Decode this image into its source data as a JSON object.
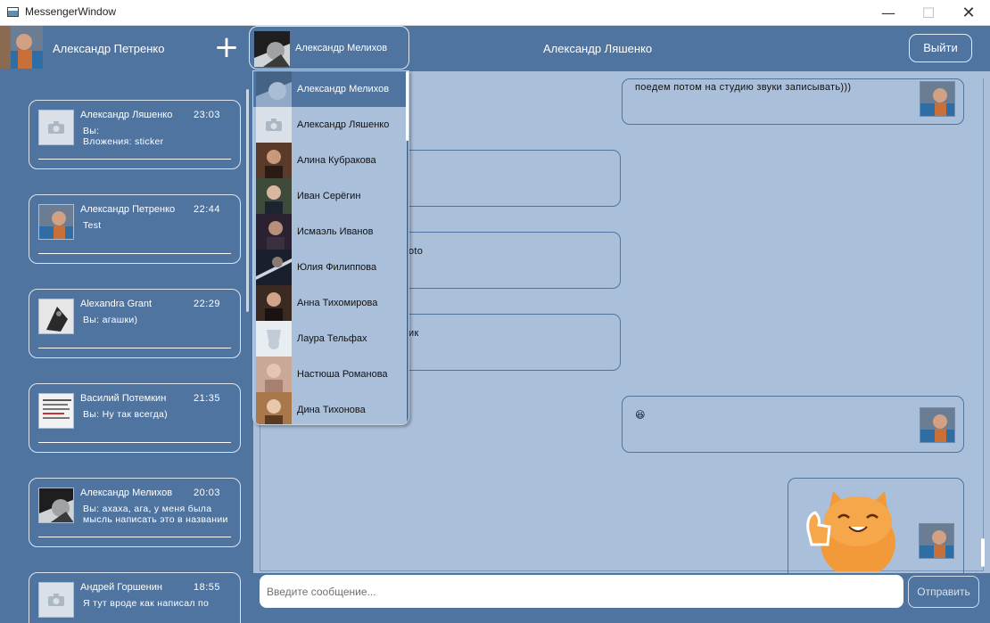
{
  "window": {
    "title": "MessengerWindow"
  },
  "header": {
    "me_name": "Александр Петренко",
    "add_label": "+",
    "selected_contact": "Александр Мелихов",
    "chat_title": "Александр Ляшенко",
    "logout_label": "Выйти"
  },
  "dialogs": [
    {
      "name": "Александр Ляшенко",
      "time": "23:03",
      "message": "Вы:\nВложения: sticker"
    },
    {
      "name": "Александр Петренко",
      "time": "22:44",
      "message": "Test"
    },
    {
      "name": "Alexandra Grant",
      "time": "22:29",
      "message": "Вы: агашки)"
    },
    {
      "name": "Василий Потемкин",
      "time": "21:35",
      "message": "Вы: Ну так всегда)"
    },
    {
      "name": "Александр Мелихов",
      "time": "20:03",
      "message": "Вы: ахаха, ага, у меня была мысль написать это в названии"
    },
    {
      "name": "Андрей Горшенин",
      "time": "18:55",
      "message": "Я тут вроде как написал по"
    }
  ],
  "messages": [
    {
      "text": "поедем потом на студию звуки записывать)))"
    },
    {
      "text": ""
    },
    {
      "text": "oto"
    },
    {
      "text": "ик"
    },
    {
      "text": "😆"
    },
    {
      "text": ""
    }
  ],
  "dropdown": {
    "contacts": [
      "Александр Мелихов",
      "Александр Ляшенко",
      "Алина Кубракова",
      "Иван Серёгин",
      "Исмаэль Иванов",
      "Юлия Филиппова",
      "Анна Тихомирова",
      "Лаура Тельфах",
      "Настюша Романова",
      "Дина Тихонова"
    ]
  },
  "input": {
    "placeholder": "Введите сообщение...",
    "send_label": "Отправить"
  },
  "colors": {
    "primary": "#4f74a0",
    "chat_bg": "#aabfda",
    "text_light": "#ffffff"
  }
}
